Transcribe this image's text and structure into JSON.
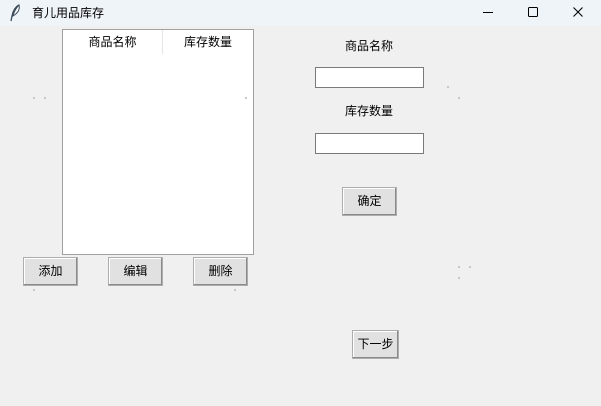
{
  "window": {
    "title": "育儿用品库存"
  },
  "icons": {
    "app": "feather-icon",
    "minimize": "minimize-icon",
    "maximize": "maximize-icon",
    "close": "close-icon"
  },
  "table": {
    "columns": [
      "商品名称",
      "库存数量"
    ],
    "rows": []
  },
  "form": {
    "name_label": "商品名称",
    "name_value": "",
    "qty_label": "库存数量",
    "qty_value": "",
    "confirm_label": "确定"
  },
  "actions": {
    "add_label": "添加",
    "edit_label": "编辑",
    "delete_label": "删除"
  },
  "footer": {
    "next_label": "下一步"
  }
}
